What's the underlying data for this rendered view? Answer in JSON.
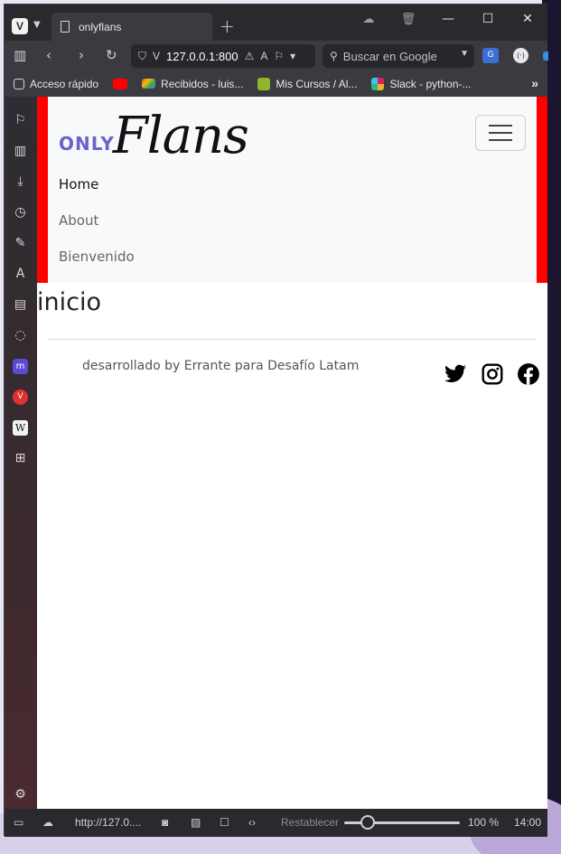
{
  "browser": {
    "tab_title": "onlyflans",
    "address": "127.0.0.1:800",
    "search_placeholder": "Buscar en Google"
  },
  "bookmarks": [
    {
      "label": "Acceso rápido",
      "icon": "speed-dial-icon"
    },
    {
      "label": "",
      "icon": "youtube-icon"
    },
    {
      "label": "Recibidos - luis...",
      "icon": "gmail-icon"
    },
    {
      "label": "Mis Cursos / Al...",
      "icon": "course-icon"
    },
    {
      "label": "Slack - python-...",
      "icon": "slack-icon"
    }
  ],
  "statusbar": {
    "url": "http://127.0....",
    "reset_label": "Restablecer",
    "zoom": "100 %",
    "clock": "14:00",
    "zoom_level": 1.0
  },
  "site": {
    "brand_only": "ONLY",
    "brand_flans": "Flans",
    "nav": [
      "Home",
      "About",
      "Bienvenido"
    ],
    "page_title": "inicio",
    "footer_text": "desarrollado by Errante para Desafío Latam",
    "social": [
      "twitter-icon",
      "instagram-icon",
      "facebook-icon"
    ]
  },
  "colors": {
    "header_border": "#ff0000",
    "brand_only": "#6c63c8",
    "header_bg": "#f8f9fa"
  }
}
